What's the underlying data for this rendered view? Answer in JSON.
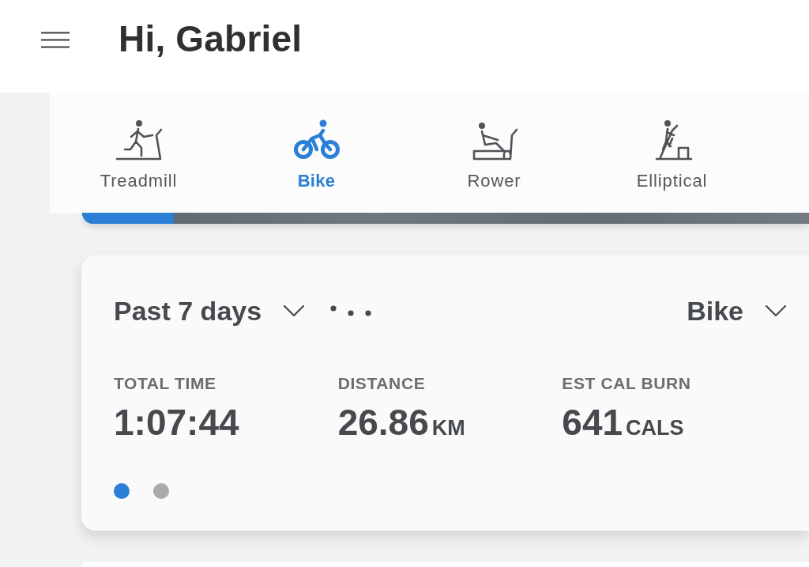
{
  "header": {
    "title": "Hi, Gabriel"
  },
  "equipment_tabs": [
    {
      "label": "Treadmill",
      "kind": "treadmill",
      "selected": false
    },
    {
      "label": "Bike",
      "kind": "bike",
      "selected": true
    },
    {
      "label": "Rower",
      "kind": "rower",
      "selected": false
    },
    {
      "label": "Elliptical",
      "kind": "elliptical",
      "selected": false
    }
  ],
  "banner": {
    "level": 0.126
  },
  "summary_card": {
    "period": "Past 7 days",
    "equipment": "Bike",
    "stats": [
      {
        "label": "TOTAL TIME",
        "value": "1:07:44"
      },
      {
        "label": "DISTANCE",
        "value": "26.86",
        "unit": "KM"
      },
      {
        "label": "EST CAL BURN",
        "value": "641",
        "unit": "CALS"
      }
    ],
    "pages": [
      {
        "selected": true
      },
      {
        "selected": false
      }
    ]
  }
}
